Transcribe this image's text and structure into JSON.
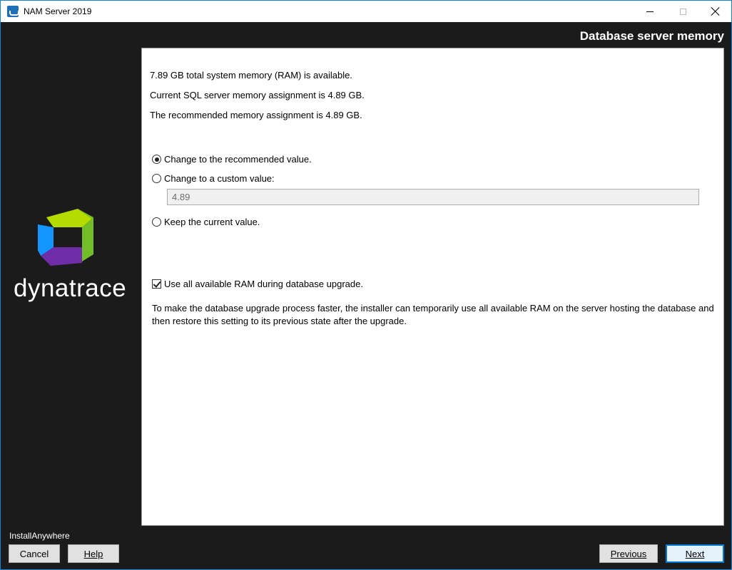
{
  "window": {
    "title": "NAM Server 2019"
  },
  "header": {
    "title": "Database server memory"
  },
  "info": {
    "total_memory": "7.89 GB total system memory (RAM) is available.",
    "current_assignment": "Current SQL server memory assignment is 4.89 GB.",
    "recommended_assignment": "The recommended memory assignment is 4.89 GB."
  },
  "options": {
    "recommended_label": "Change to the recommended value.",
    "custom_label": "Change to a custom value:",
    "custom_value": "4.89",
    "keep_label": "Keep the current value.",
    "selected": "recommended"
  },
  "upgrade": {
    "checkbox_label": "Use all available RAM during database upgrade.",
    "checked": true,
    "description": "To make the database upgrade process faster, the installer can temporarily use all available RAM on the server hosting the database and then restore this setting to its previous state after the upgrade."
  },
  "branding": {
    "logo_text": "dynatrace",
    "footer_label": "InstallAnywhere"
  },
  "buttons": {
    "cancel": "Cancel",
    "help": "Help",
    "previous": "Previous",
    "next": "Next"
  },
  "colors": {
    "background": "#1b1b1b",
    "accent": "#0078d7",
    "logo_green": "#73be28",
    "logo_blue": "#1496ff",
    "logo_purple": "#6f2da8"
  }
}
